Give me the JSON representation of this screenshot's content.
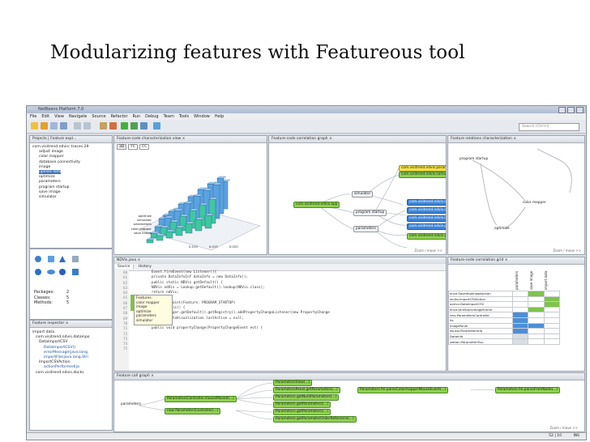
{
  "slide_title": "Modularizing features with Featureous tool",
  "window": {
    "title": "NetBeans Platform 7.0"
  },
  "menu": [
    "File",
    "Edit",
    "View",
    "Navigate",
    "Source",
    "Refactor",
    "Run",
    "Debug",
    "Team",
    "Tools",
    "Window",
    "Help"
  ],
  "search_placeholder": "Search (Ctrl+I)",
  "projects_panel": {
    "tabs": "Projects | Feature expl...",
    "items": [
      "com.visitrend.ndvis: traces 29",
      "adjust image",
      "color mapper",
      "database connectivity",
      "image",
      "upload data",
      "optimize",
      "parameters",
      "program startup",
      "save image",
      "simulator"
    ],
    "selected_index": 5
  },
  "palette_panel": {
    "labels": [
      "Packages:",
      "Classes:",
      "Methods:"
    ],
    "values": [
      "2",
      "5",
      "5"
    ]
  },
  "inspector_panel": {
    "tab": "Feature inspector  ×",
    "items": [
      "import data",
      "com.visitrend.ndvis.datainpo",
      "DataImportCSV",
      "DataImportCSV()",
      "errorMessage(java.lang",
      "importFile(java.lang.Stri",
      "ImportCSVAction",
      "actionPerformed(ja",
      "com.visitrend.ndvis.docks"
    ]
  },
  "char_view": {
    "tab": "Feature-code characterization view  ×",
    "buttons": [
      "3D",
      "FC",
      "CC"
    ],
    "axis_labels": [
      "optimize",
      "simulator",
      "parameters",
      "color mapper",
      "save image"
    ],
    "axis_values": [
      "0.010",
      "0.015",
      "0.020"
    ]
  },
  "corr_graph": {
    "tab": "Feature-code correlation graph  ×",
    "nodes": [
      "com.visitrend.ndvis.parameters",
      "com.visitrend.ndvis.comu",
      "com.visitrend.ndvis.app",
      "simulator",
      "program startup",
      "parameters",
      "com.visitrend.ndvis.img",
      "com.visitrend.ndvis.optm",
      "com.visitrend.ndvis.layer.web",
      "com.visitrend.ndvis.gui.pd",
      "com.visitrend.ndvis.gui.pd"
    ],
    "footer": "Zoom / move >>"
  },
  "relations": {
    "tab": "Feature relations characterization  ×",
    "nodes": [
      "program startup",
      "color mapper",
      "optimize"
    ],
    "footer": "Zoom / move >>"
  },
  "editor": {
    "tab": "NDVis.java  ×",
    "subtabs": [
      "Source",
      "History"
    ],
    "code": [
      "    Event.fireEvent(new Listener(){",
      "    private DataInfoInf dataInfo = new DataInfo();",
      "",
      "    public static NDVis getDefault() {",
      "        NDVis ndVis = Lookup.getDefault().lookup(NDVis.class);",
      "        return ndVis;",
      "    }",
      "",
      "    @OnEntityPoint(Feature: PROGRAM_STARTUP)",
      "    public NDVis() {",
      "",
      "        WindowManager.getDefault().getRegistry().addPropertyChangeListener(new PropertyChange",
      "            private DataVisualization lastActive = null;",
      "",
      "            @Override",
      "            public void propertyChange(PropertyChangeEvent evt) {"
    ],
    "line_numbers": [
      "60",
      "61",
      "62",
      "63",
      "64",
      "65",
      "66",
      "67",
      "68",
      "69",
      "70",
      "71",
      "72",
      "73",
      "74",
      "75"
    ],
    "tooltip_title": "Features:",
    "tooltip_items": [
      "color mapper",
      "image",
      "optimize",
      "parameters",
      "simulator"
    ]
  },
  "correlation_grid": {
    "tab": "Feature-code correlation grid  ×",
    "columns": [
      "parameters",
      "save image",
      "import data"
    ],
    "rows": [
      "ence.SaveImgImageAction",
      "ion/to.ImportCSVAction",
      "oortcv.DataImportCSV",
      "ence.DimStackImageFrame",
      "ters.ParametersController",
      "lts",
      "ImagePanel",
      "tbl.api.ParameterInfo",
      "DataInfo",
      "ization.ParameterVisu"
    ],
    "cells": [
      [
        "",
        "#7fc34a",
        ""
      ],
      [
        "",
        "",
        "#7fc34a"
      ],
      [
        "",
        "",
        "#7fc34a"
      ],
      [
        "",
        "#7fc34a",
        ""
      ],
      [
        "#4a8fd8",
        "",
        ""
      ],
      [
        "#4a8fd8",
        "",
        ""
      ],
      [
        "#4a8fd8",
        "#4a8fd8",
        ""
      ],
      [
        "#4a8fd8",
        "",
        ""
      ],
      [
        "#d8dde3",
        "",
        ""
      ],
      [
        "#d8dde3",
        "",
        ""
      ]
    ]
  },
  "call_graph": {
    "tab": "Feature call graph  ×",
    "nodes": [
      "parameters",
      "ParametersController.mouseMoved(...)",
      "new ParametersController(...)",
      "ParametersView(...)",
      "ParametersPanel.getParameters(...)",
      "Parameters.fnl.parseColormapperMouseEvent(...)",
      "Parameters.getNumParameters(...)",
      "Parameters.getParameters(...)",
      "Parameters.getParameters(...)",
      "Parameters.getParameterOrderReference(...)",
      "Parameters.fnl.parseFromNode(...)"
    ],
    "footer": "Zoom / move >>"
  },
  "statusbar": {
    "position": "52 | 10",
    "mode": "INS"
  }
}
